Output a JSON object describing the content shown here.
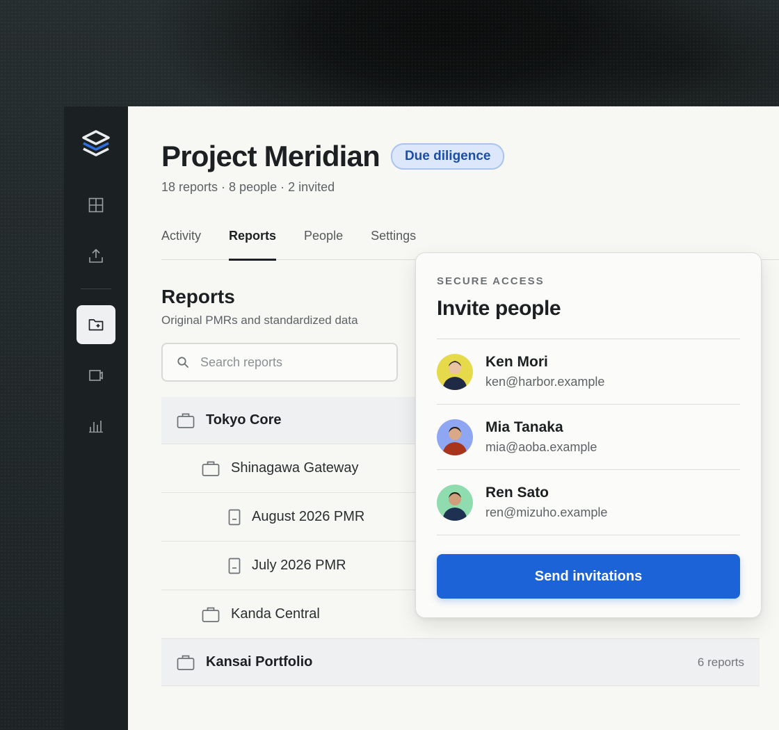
{
  "project": {
    "title": "Project Meridian",
    "badge": "Due diligence",
    "meta": "18 reports · 8 people · 2 invited"
  },
  "tabs": [
    {
      "label": "Activity",
      "active": false
    },
    {
      "label": "Reports",
      "active": true
    },
    {
      "label": "People",
      "active": false
    },
    {
      "label": "Settings",
      "active": false
    }
  ],
  "reports": {
    "title": "Reports",
    "subtitle": "Original PMRs and standardized data",
    "search_placeholder": "Search reports"
  },
  "tree": [
    {
      "label": "Tokyo Core",
      "kind": "portfolio",
      "count": ""
    },
    {
      "label": "Shinagawa Gateway",
      "kind": "property",
      "count": ""
    },
    {
      "label": "August 2026 PMR",
      "kind": "report",
      "count": ""
    },
    {
      "label": "July 2026 PMR",
      "kind": "report",
      "count": ""
    },
    {
      "label": "Kanda Central",
      "kind": "property",
      "count": ""
    },
    {
      "label": "Kansai Portfolio",
      "kind": "portfolio",
      "count": "6 reports"
    }
  ],
  "invite": {
    "eyebrow": "SECURE ACCESS",
    "title": "Invite people",
    "people": [
      {
        "name": "Ken Mori",
        "email": "ken@harbor.example",
        "avatar_bg": "#e6d94a"
      },
      {
        "name": "Mia Tanaka",
        "email": "mia@aoba.example",
        "avatar_bg": "#8fa6f2"
      },
      {
        "name": "Ren Sato",
        "email": "ren@mizuho.example",
        "avatar_bg": "#8fdcae"
      }
    ],
    "send_label": "Send invitations"
  },
  "colors": {
    "accent": "#1b63d6",
    "badge_bg": "#dce7fb",
    "badge_text": "#1d4ea6",
    "rail_bg": "#1b2022"
  }
}
